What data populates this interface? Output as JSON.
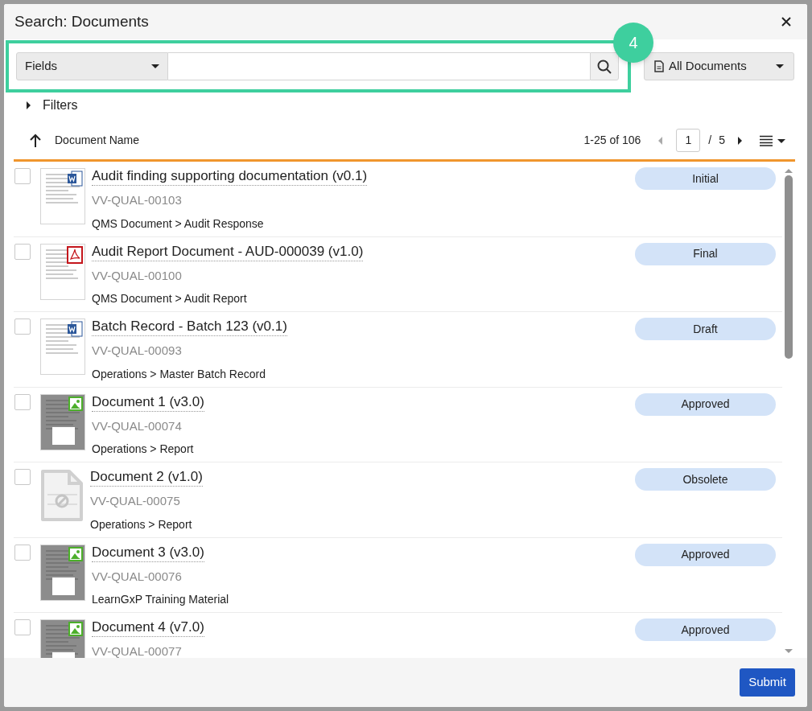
{
  "window": {
    "title": "Search: Documents"
  },
  "search": {
    "field_selector": "Fields",
    "annotation_badge": "4",
    "scope": "All Documents"
  },
  "filters": {
    "label": "Filters",
    "expanded": false
  },
  "list_header": {
    "sort_column": "Document Name",
    "range": "1-25 of 106",
    "page": "1",
    "separator": "/",
    "total_pages": "5"
  },
  "documents": [
    {
      "title": "Audit finding supporting documentation (v0.1)",
      "id": "VV-QUAL-00103",
      "path": "QMS Document > Audit Response",
      "status": "Initial",
      "kind": "word",
      "checked": false
    },
    {
      "title": "Audit Report Document - AUD-000039 (v1.0)",
      "id": "VV-QUAL-00100",
      "path": "QMS Document > Audit Report",
      "status": "Final",
      "kind": "pdf",
      "checked": false
    },
    {
      "title": "Batch Record - Batch 123 (v0.1)",
      "id": "VV-QUAL-00093",
      "path": "Operations > Master Batch Record",
      "status": "Draft",
      "kind": "word",
      "checked": false
    },
    {
      "title": "Document 1 (v3.0)",
      "id": "VV-QUAL-00074",
      "path": "Operations > Report",
      "status": "Approved",
      "kind": "image",
      "checked": false
    },
    {
      "title": "Document 2 (v1.0)",
      "id": "VV-QUAL-00075",
      "path": "Operations > Report",
      "status": "Obsolete",
      "kind": "blank",
      "checked": false
    },
    {
      "title": "Document 3 (v3.0)",
      "id": "VV-QUAL-00076",
      "path": "LearnGxP Training Material",
      "status": "Approved",
      "kind": "image",
      "checked": false
    },
    {
      "title": "Document 4 (v7.0)",
      "id": "VV-QUAL-00077",
      "status": "Approved",
      "kind": "image",
      "checked": false
    }
  ],
  "footer": {
    "submit": "Submit"
  }
}
